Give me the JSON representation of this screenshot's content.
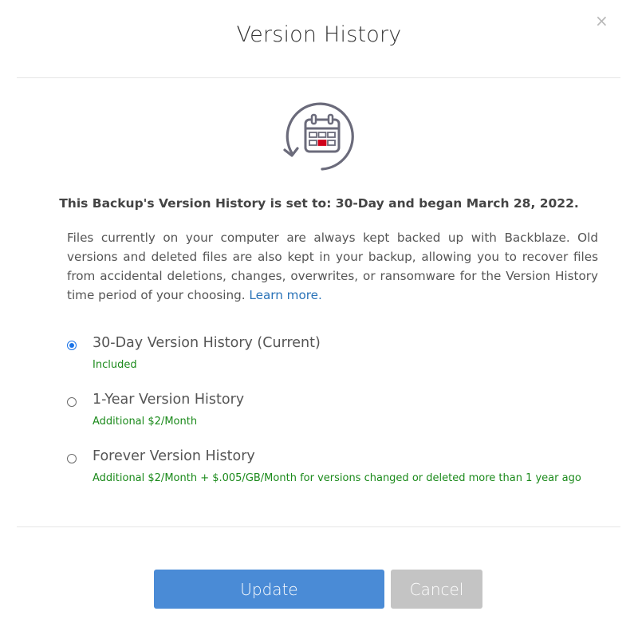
{
  "dialog": {
    "title": "Version History",
    "close_symbol": "×"
  },
  "icon": {
    "name": "calendar-history-icon",
    "stroke_color": "#6b6b7b",
    "highlight_color": "#d0021b"
  },
  "summary": "This Backup's Version History is set to: 30-Day and began March 28, 2022.",
  "description": {
    "text": "Files currently on your computer are always kept backed up with Backblaze. Old versions and deleted files are also kept in your backup, allowing you to recover files from accidental deletions, changes, overwrites, or ransomware for the Version History time period of your choosing. ",
    "link_label": "Learn more."
  },
  "options": [
    {
      "label": "30-Day Version History (Current)",
      "price": "Included",
      "selected": true
    },
    {
      "label": "1-Year Version History",
      "price": "Additional $2/Month",
      "selected": false
    },
    {
      "label": "Forever Version History",
      "price": "Additional $2/Month + $.005/GB/Month for versions changed or deleted more than 1 year ago",
      "selected": false
    }
  ],
  "buttons": {
    "update_label": "Update",
    "cancel_label": "Cancel"
  },
  "colors": {
    "primary": "#4a8bd6",
    "disabled": "#c4c4c4",
    "price_green": "#1b8a1b",
    "link_blue": "#2a73b8"
  }
}
